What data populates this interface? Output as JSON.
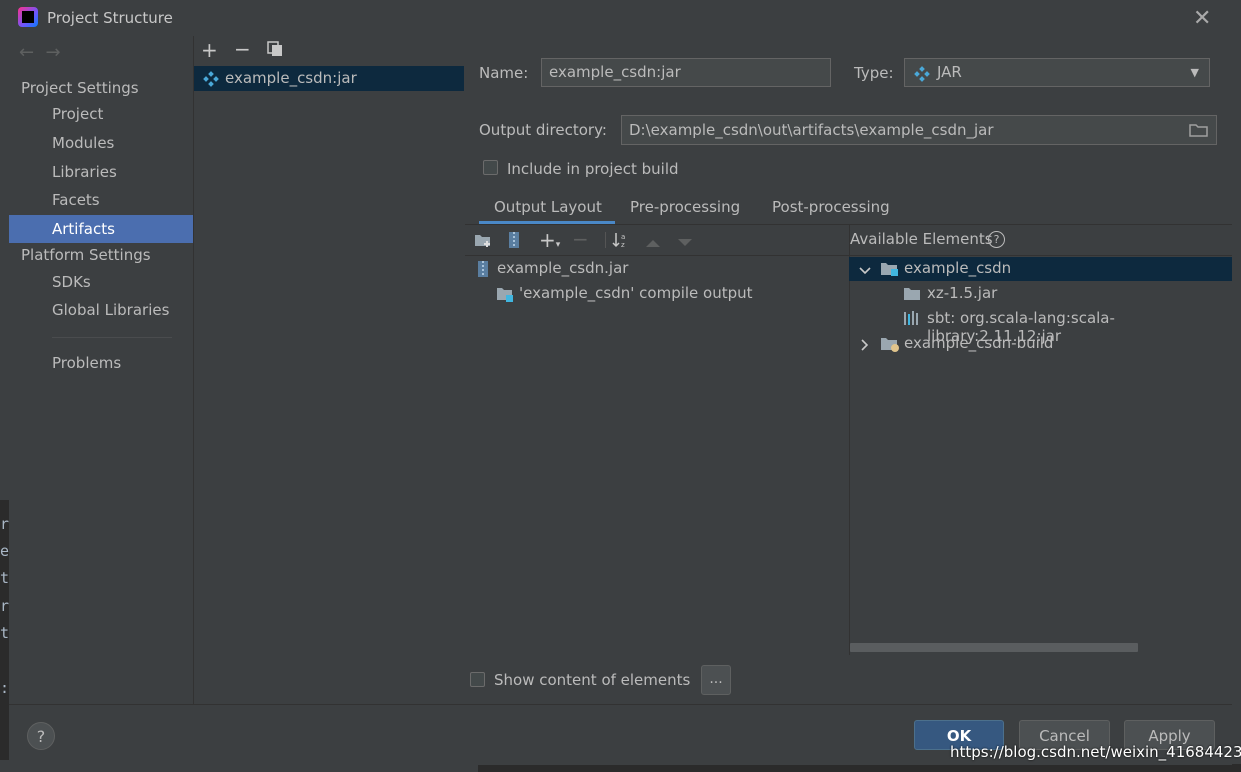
{
  "window": {
    "title": "Project Structure"
  },
  "sidebar": {
    "project_settings_heading": "Project Settings",
    "project_items": [
      {
        "label": "Project"
      },
      {
        "label": "Modules"
      },
      {
        "label": "Libraries"
      },
      {
        "label": "Facets"
      },
      {
        "label": "Artifacts",
        "selected": true
      }
    ],
    "platform_settings_heading": "Platform Settings",
    "platform_items": [
      {
        "label": "SDKs"
      },
      {
        "label": "Global Libraries"
      }
    ],
    "problems_label": "Problems"
  },
  "artifacts_list": {
    "items": [
      {
        "label": "example_csdn:jar",
        "icon": "jar-artifact-icon"
      }
    ]
  },
  "artifact_form": {
    "name_label": "Name:",
    "name_value": "example_csdn:jar",
    "type_label": "Type:",
    "type_value": "JAR",
    "output_dir_label": "Output directory:",
    "output_dir_value": "D:\\example_csdn\\out\\artifacts\\example_csdn_jar",
    "include_in_build_label": "Include in project build",
    "include_in_build_checked": false
  },
  "tabs": [
    {
      "label": "Output Layout",
      "active": true
    },
    {
      "label": "Pre-processing"
    },
    {
      "label": "Post-processing"
    }
  ],
  "output_layout": {
    "tree": [
      {
        "label": "example_csdn.jar",
        "icon": "jar-file-icon"
      },
      {
        "label": "'example_csdn' compile output",
        "icon": "folder-module-icon"
      }
    ],
    "show_content_label": "Show content of elements",
    "show_content_checked": false,
    "dots_label": "..."
  },
  "available_elements": {
    "heading": "Available Elements",
    "tree": [
      {
        "label": "example_csdn",
        "expanded": true,
        "selected": true
      },
      {
        "label": "xz-1.5.jar"
      },
      {
        "label": "sbt: org.scala-lang:scala-library:2.11.12:jar"
      },
      {
        "label": "example_csdn-build",
        "expanded": false
      }
    ]
  },
  "footer": {
    "help_label": "?",
    "ok_label": "OK",
    "cancel_label": "Cancel",
    "apply_label": "Apply"
  },
  "watermark": "https://blog.csdn.net/weixin_41684423",
  "background_chars": [
    "r",
    "e",
    "t",
    "r",
    "t",
    ":"
  ],
  "colors": {
    "selection": "#4b6eaf",
    "tree_selection": "#0d293e",
    "tab_underline": "#4a88c7",
    "ok_button": "#365880"
  }
}
